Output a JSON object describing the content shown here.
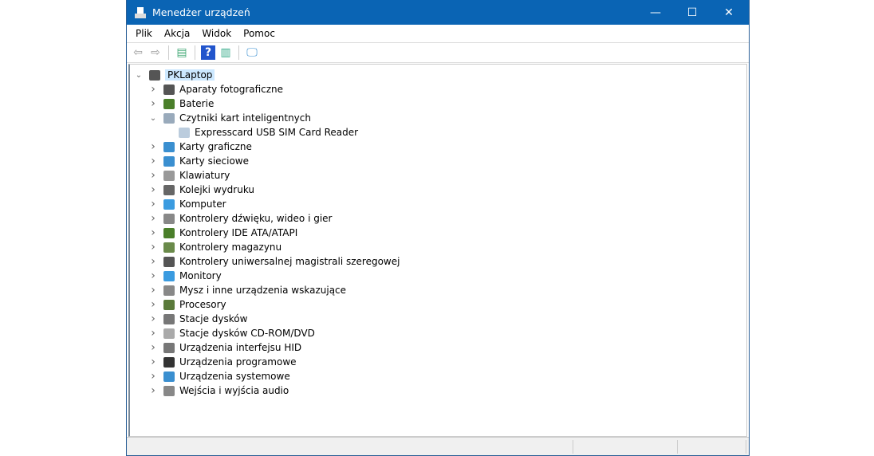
{
  "window": {
    "title": "Menedżer urządzeń",
    "minimize": "—",
    "maximize": "☐",
    "close": "✕"
  },
  "menu": [
    "Plik",
    "Akcja",
    "Widok",
    "Pomoc"
  ],
  "toolbar": [
    {
      "icon": "back-icon",
      "glyph": "⇦"
    },
    {
      "icon": "forward-icon",
      "glyph": "⇨"
    },
    {
      "icon": "properties-icon",
      "glyph": "▤"
    },
    {
      "icon": "help-icon",
      "glyph": "?"
    },
    {
      "icon": "update-driver-icon",
      "glyph": "▥"
    },
    {
      "icon": "scan-hardware-icon",
      "glyph": "🖵"
    }
  ],
  "tree": {
    "root": "PKLaptop",
    "items": [
      {
        "label": "Aparaty fotograficzne",
        "color": "#555",
        "expanded": false
      },
      {
        "label": "Baterie",
        "color": "#4a7f2a",
        "expanded": false
      },
      {
        "label": "Czytniki kart inteligentnych",
        "color": "#9ab",
        "expanded": true,
        "children": [
          "Expresscard USB SIM Card Reader"
        ]
      },
      {
        "label": "Karty graficzne",
        "color": "#3a8fd0",
        "expanded": false
      },
      {
        "label": "Karty sieciowe",
        "color": "#3a8fd0",
        "expanded": false
      },
      {
        "label": "Klawiatury",
        "color": "#999",
        "expanded": false
      },
      {
        "label": "Kolejki wydruku",
        "color": "#666",
        "expanded": false
      },
      {
        "label": "Komputer",
        "color": "#3a9be0",
        "expanded": false
      },
      {
        "label": "Kontrolery dźwięku, wideo i gier",
        "color": "#888",
        "expanded": false
      },
      {
        "label": "Kontrolery IDE ATA/ATAPI",
        "color": "#4a7f2a",
        "expanded": false
      },
      {
        "label": "Kontrolery magazynu",
        "color": "#6a8a4a",
        "expanded": false
      },
      {
        "label": "Kontrolery uniwersalnej magistrali szeregowej",
        "color": "#555",
        "expanded": false
      },
      {
        "label": "Monitory",
        "color": "#3a9be0",
        "expanded": false
      },
      {
        "label": "Mysz i inne urządzenia wskazujące",
        "color": "#888",
        "expanded": false
      },
      {
        "label": "Procesory",
        "color": "#5a7a3a",
        "expanded": false
      },
      {
        "label": "Stacje dysków",
        "color": "#777",
        "expanded": false
      },
      {
        "label": "Stacje dysków CD-ROM/DVD",
        "color": "#aaa",
        "expanded": false
      },
      {
        "label": "Urządzenia interfejsu HID",
        "color": "#777",
        "expanded": false
      },
      {
        "label": "Urządzenia programowe",
        "color": "#333",
        "expanded": false
      },
      {
        "label": "Urządzenia systemowe",
        "color": "#3a8fd0",
        "expanded": false
      },
      {
        "label": "Wejścia i wyjścia audio",
        "color": "#888",
        "expanded": false
      }
    ]
  }
}
